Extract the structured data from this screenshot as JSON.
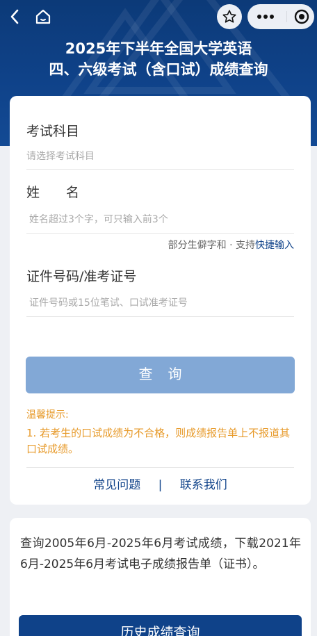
{
  "header": {
    "title_line1": "2025年下半年全国大学英语",
    "title_line2": "四、六级考试（含口试）成绩查询"
  },
  "form": {
    "subject_label": "考试科目",
    "subject_placeholder": "请选择考试科目",
    "name_label": "姓　　名",
    "name_placeholder": "姓名超过3个字，可只输入前3个",
    "rare_char_text": "部分生僻字和 · 支持",
    "quick_input_link": "快捷输入",
    "id_label": "证件号码/准考证号",
    "id_placeholder": "证件号码或15位笔试、口试准考证号",
    "query_button": "查询"
  },
  "tips": {
    "title": "温馨提示:",
    "item1": "1. 若考生的口试成绩为不合格，则成绩报告单上不报道其口试成绩。"
  },
  "footer_links": {
    "faq": "常见问题",
    "separator": "|",
    "contact": "联系我们"
  },
  "history": {
    "description": "查询2005年6月-2025年6月考试成绩，下载2021年6月-2025年6月考试电子成绩报告单（证书）。",
    "button": "历史成绩查询"
  },
  "colors": {
    "brand": "#0f4289",
    "query_button_disabled": "#82a8d6",
    "tips": "#e79a2a"
  }
}
